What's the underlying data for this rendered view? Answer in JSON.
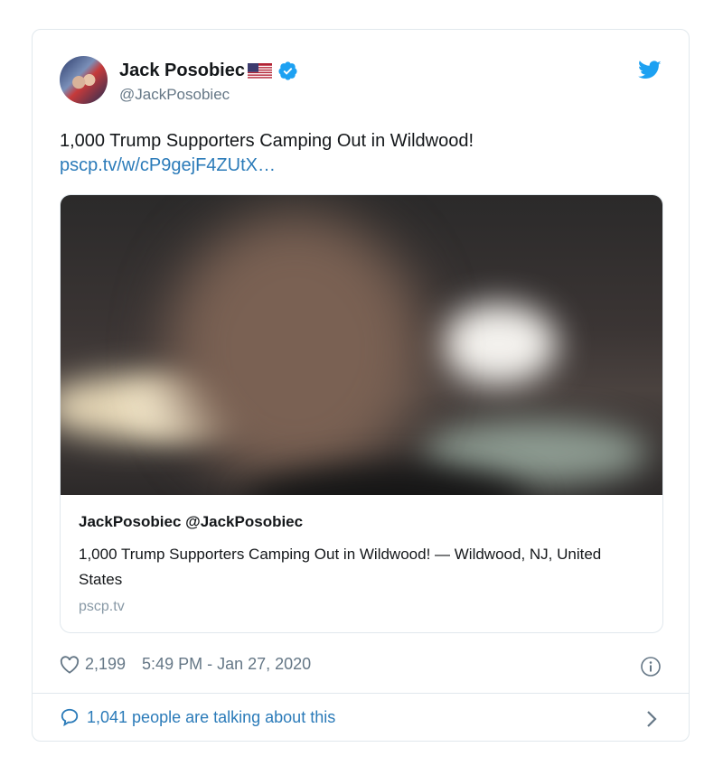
{
  "author": {
    "display_name": "Jack Posobiec",
    "handle": "@JackPosobiec"
  },
  "tweet": {
    "text": "1,000 Trump Supporters Camping Out in Wildwood!",
    "link": "pscp.tv/w/cP9gejF4ZUtX…"
  },
  "link_card": {
    "title": "JackPosobiec @JackPosobiec",
    "description": "1,000 Trump Supporters Camping Out in Wildwood! — Wildwood, NJ, United States",
    "domain": "pscp.tv"
  },
  "meta": {
    "likes": "2,199",
    "timestamp": "5:49 PM - Jan 27, 2020"
  },
  "footer": {
    "talking": "1,041 people are talking about this"
  },
  "icons": {
    "verified": "verified-badge-icon",
    "flag": "us-flag-icon",
    "brand": "twitter-bird-icon",
    "like": "heart-icon",
    "info": "info-icon",
    "reply": "speech-bubble-icon",
    "more": "chevron-right-icon"
  },
  "colors": {
    "accent": "#1da1f2",
    "link": "#2b7bb9",
    "muted": "#657786",
    "border": "#e1e8ed"
  }
}
